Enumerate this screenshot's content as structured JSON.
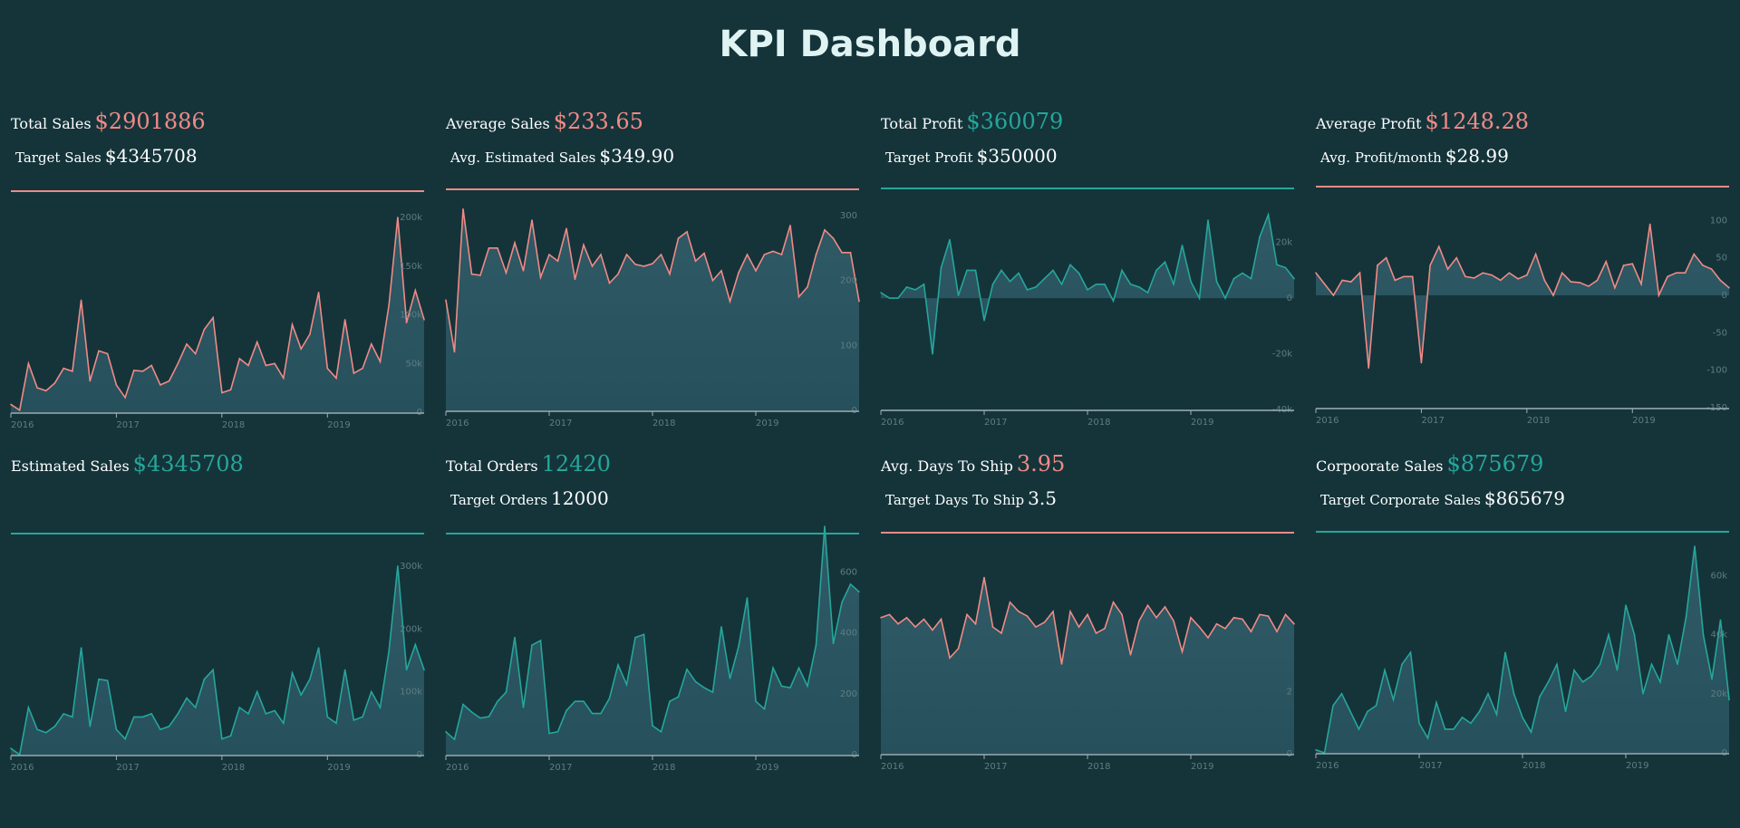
{
  "title": "KPI Dashboard",
  "x_ticks": [
    "2016",
    "2017",
    "2018",
    "2019"
  ],
  "panels": [
    {
      "label": "Total Sales",
      "value": "$2901886",
      "value_color": "#f08a86",
      "sub_label": "Target Sales",
      "sub_value": "$4345708",
      "rule_color": "#f08a86"
    },
    {
      "label": "Average Sales",
      "value": "$233.65",
      "value_color": "#f08a86",
      "sub_label": "Avg. Estimated Sales",
      "sub_value": "$349.90",
      "rule_color": "#f08a86"
    },
    {
      "label": "Total Profit",
      "value": "$360079",
      "value_color": "#26a69a",
      "sub_label": "Target Profit",
      "sub_value": "$350000",
      "rule_color": "#26a69a"
    },
    {
      "label": "Average Profit",
      "value": "$1248.28",
      "value_color": "#f08a86",
      "sub_label": "Avg. Profit/month",
      "sub_value": "$28.99",
      "rule_color": "#f08a86"
    },
    {
      "label": "Estimated Sales",
      "value": "$4345708",
      "value_color": "#26a69a",
      "sub_label": "",
      "sub_value": "",
      "rule_color": "#26a69a"
    },
    {
      "label": "Total Orders",
      "value": "12420",
      "value_color": "#26a69a",
      "sub_label": "Target Orders",
      "sub_value": "12000",
      "rule_color": "#26a69a"
    },
    {
      "label": "Avg. Days To Ship",
      "value": "3.95",
      "value_color": "#f08a86",
      "sub_label": "Target Days To Ship",
      "sub_value": "3.5",
      "rule_color": "#f08a86"
    },
    {
      "label": "Corpoorate Sales",
      "value": "$875679",
      "value_color": "#26a69a",
      "sub_label": "Target Corporate Sales",
      "sub_value": "$865679",
      "rule_color": "#26a69a"
    }
  ],
  "chart_data": [
    {
      "type": "area",
      "line_color": "#f08a86",
      "yticks": [
        "0",
        "50k",
        "100k",
        "150k",
        "200k"
      ],
      "ylim": [
        0,
        200000
      ],
      "x_start": "2016-01",
      "x_end": "2019-12",
      "values": [
        8000,
        2000,
        50000,
        25000,
        22000,
        30000,
        45000,
        42000,
        115000,
        32000,
        63000,
        60000,
        28000,
        15000,
        43000,
        42000,
        48000,
        28000,
        32000,
        50000,
        70000,
        60000,
        85000,
        97000,
        20000,
        23000,
        55000,
        48000,
        72000,
        48000,
        50000,
        35000,
        90000,
        65000,
        80000,
        123000,
        45000,
        35000,
        95000,
        40000,
        45000,
        70000,
        52000,
        110000,
        200000,
        92000,
        125000,
        95000
      ]
    },
    {
      "type": "area",
      "line_color": "#f08a86",
      "yticks": [
        "0",
        "100",
        "200",
        "300"
      ],
      "ylim": [
        0,
        300
      ],
      "x_start": "2016-01",
      "x_end": "2019-12",
      "values": [
        170,
        90,
        310,
        210,
        208,
        250,
        250,
        212,
        258,
        215,
        293,
        205,
        240,
        230,
        280,
        202,
        255,
        222,
        240,
        196,
        210,
        240,
        225,
        222,
        226,
        240,
        210,
        265,
        275,
        230,
        242,
        200,
        215,
        168,
        212,
        240,
        215,
        240,
        245,
        240,
        285,
        175,
        190,
        240,
        278,
        265,
        243,
        243,
        168
      ]
    },
    {
      "type": "area",
      "line_color": "#26a69a",
      "yticks": [
        "-40k",
        "-20k",
        "0",
        "20k"
      ],
      "ylim": [
        -40000,
        30000
      ],
      "x_start": "2016-01",
      "x_end": "2019-12",
      "values": [
        2000,
        0,
        0,
        4000,
        3000,
        5000,
        -20000,
        11000,
        21000,
        1000,
        10000,
        10000,
        -8000,
        5000,
        10000,
        6000,
        9000,
        3000,
        4000,
        7000,
        10000,
        5000,
        12000,
        9000,
        3000,
        5000,
        5000,
        -1000,
        10000,
        5000,
        4000,
        2000,
        10000,
        13000,
        5000,
        19000,
        6000,
        0,
        28000,
        6000,
        0,
        7000,
        9000,
        7000,
        22000,
        30000,
        12000,
        11000,
        7000
      ]
    },
    {
      "type": "area",
      "line_color": "#f08a86",
      "yticks": [
        "-150",
        "-100",
        "-50",
        "0",
        "50",
        "100"
      ],
      "ylim": [
        -150,
        110
      ],
      "x_start": "2016-01",
      "x_end": "2019-12",
      "values": [
        30,
        15,
        0,
        20,
        18,
        30,
        -97,
        40,
        50,
        20,
        25,
        25,
        -90,
        40,
        65,
        35,
        50,
        25,
        23,
        30,
        27,
        20,
        30,
        22,
        27,
        55,
        20,
        0,
        30,
        18,
        17,
        12,
        20,
        45,
        10,
        40,
        42,
        15,
        95,
        0,
        25,
        30,
        30,
        55,
        40,
        35,
        20,
        10
      ]
    },
    {
      "type": "area",
      "line_color": "#26a69a",
      "yticks": [
        "0",
        "100k",
        "200k",
        "300k"
      ],
      "ylim": [
        0,
        310000
      ],
      "x_start": "2016-01",
      "x_end": "2019-12",
      "values": [
        10000,
        0,
        75000,
        40000,
        35000,
        45000,
        65000,
        60000,
        170000,
        45000,
        120000,
        118000,
        40000,
        25000,
        60000,
        60000,
        65000,
        40000,
        45000,
        65000,
        90000,
        75000,
        120000,
        135000,
        25000,
        30000,
        75000,
        65000,
        100000,
        65000,
        70000,
        50000,
        130000,
        95000,
        120000,
        170000,
        60000,
        50000,
        135000,
        55000,
        60000,
        100000,
        75000,
        165000,
        300000,
        135000,
        175000,
        135000
      ]
    },
    {
      "type": "area",
      "line_color": "#26a69a",
      "yticks": [
        "0",
        "200",
        "400",
        "600"
      ],
      "ylim": [
        0,
        640
      ],
      "x_start": "2016-01",
      "x_end": "2019-12",
      "values": [
        75,
        50,
        165,
        140,
        120,
        125,
        175,
        205,
        385,
        155,
        360,
        375,
        70,
        75,
        145,
        175,
        175,
        135,
        135,
        185,
        295,
        230,
        385,
        395,
        95,
        75,
        175,
        190,
        280,
        240,
        220,
        205,
        420,
        250,
        355,
        515,
        175,
        150,
        285,
        225,
        220,
        285,
        225,
        360,
        750,
        365,
        500,
        560,
        535
      ]
    },
    {
      "type": "area",
      "line_color": "#f08a86",
      "yticks": [
        "0",
        "2"
      ],
      "ylim": [
        0,
        6.3
      ],
      "x_start": "2016-01",
      "x_end": "2019-12",
      "values": [
        4.4,
        4.5,
        4.2,
        4.4,
        4.1,
        4.35,
        4.0,
        4.35,
        3.1,
        3.4,
        4.5,
        4.2,
        5.7,
        4.1,
        3.9,
        4.9,
        4.6,
        4.45,
        4.1,
        4.25,
        4.6,
        2.9,
        4.6,
        4.1,
        4.5,
        3.9,
        4.05,
        4.9,
        4.5,
        3.2,
        4.3,
        4.8,
        4.4,
        4.75,
        4.3,
        3.3,
        4.4,
        4.1,
        3.75,
        4.2,
        4.05,
        4.4,
        4.35,
        3.95,
        4.5,
        4.45,
        3.95,
        4.5,
        4.2
      ]
    },
    {
      "type": "area",
      "line_color": "#26a69a",
      "yticks": [
        "0",
        "20k",
        "40k",
        "60k"
      ],
      "ylim": [
        0,
        66000
      ],
      "x_start": "2016-01",
      "x_end": "2019-12",
      "values": [
        1000,
        0,
        16000,
        20000,
        14000,
        8000,
        14000,
        16000,
        28000,
        18000,
        30000,
        34000,
        10000,
        5000,
        17000,
        8000,
        8000,
        12000,
        10000,
        14000,
        20000,
        13000,
        34000,
        20000,
        12000,
        7000,
        19000,
        24000,
        30000,
        14000,
        28000,
        24000,
        26000,
        30000,
        40000,
        28000,
        50000,
        40000,
        20000,
        30000,
        24000,
        40000,
        30000,
        46000,
        70000,
        40000,
        25000,
        45000,
        18000
      ]
    }
  ]
}
